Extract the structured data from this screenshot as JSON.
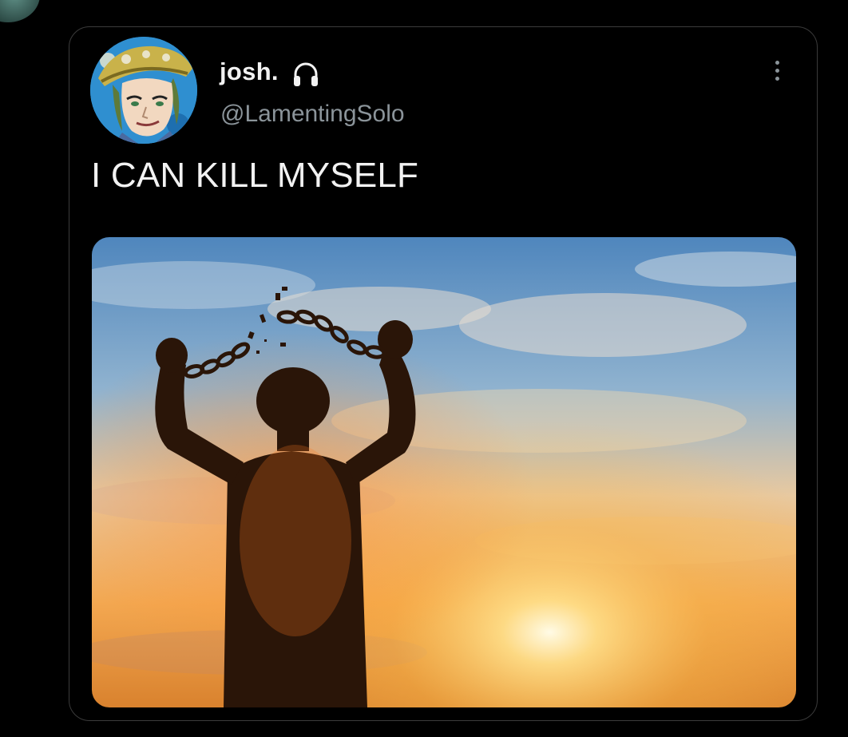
{
  "tweet": {
    "display_name": "josh.",
    "badge_icon": "headphones-icon",
    "handle": "@LamentingSolo",
    "text": "I CAN KILL MYSELF",
    "menu_icon": "more-options-icon",
    "media_description_icon": "photo"
  },
  "colors": {
    "background": "#000000",
    "card_border": "#3b3b3b",
    "primary_text": "#f2f2f2",
    "secondary_text": "#8b949a",
    "avatar_bg": "#2f8fd0"
  }
}
